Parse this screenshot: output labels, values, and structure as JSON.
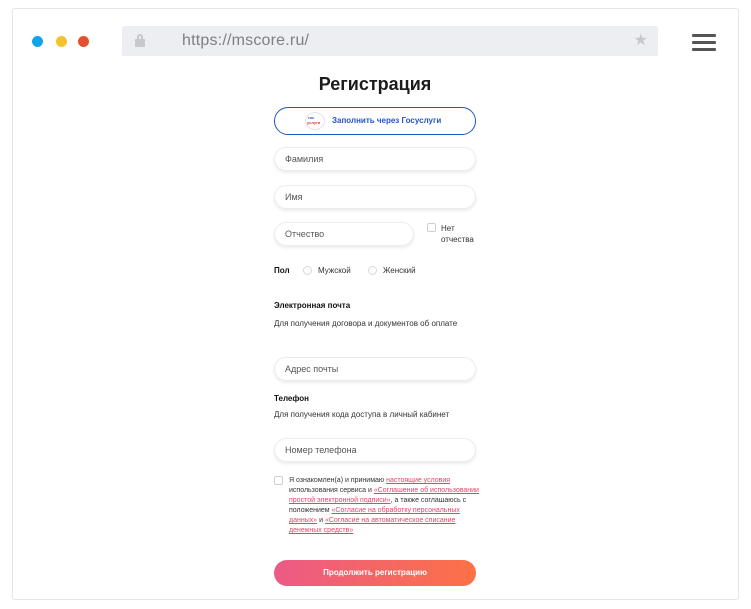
{
  "browser": {
    "url": "https://mscore.ru/",
    "dots": [
      "#14a3e8",
      "#f4c230",
      "#e4502f"
    ]
  },
  "form": {
    "title": "Регистрация",
    "gosuslugi_button": "Заполнить через Госуслуги",
    "gosuslugi_logo_line1": "гос",
    "gosuslugi_logo_line2": "услуги",
    "surname_placeholder": "Фамилия",
    "name_placeholder": "Имя",
    "patronymic_placeholder": "Отчество",
    "no_patronymic_label": "Нет отчества",
    "gender_label": "Пол",
    "gender_male": "Мужской",
    "gender_female": "Женский",
    "email_heading": "Электронная почта",
    "email_hint": "Для получения договора и документов об оплате",
    "email_placeholder": "Адрес почты",
    "phone_heading": "Телефон",
    "phone_hint": "Для получения кода доступа в личный кабинет",
    "phone_placeholder": "Номер телефона",
    "consent": {
      "t1": "Я ознакомлен(а) и принимаю ",
      "l1": "настоящие условия",
      "t2": " использования сервиса и ",
      "l2": "«Соглашение об использовании простой электронной подписи»",
      "t3": ", а также соглашаюсь с положением ",
      "l3": "«Согласие на обработку персональных данных»",
      "t4": " и ",
      "l4": "«Согласие на автоматическое списание денежных средств»"
    },
    "submit_button": "Продолжить регистрацию"
  },
  "colors": {
    "accent_blue": "#2353c7",
    "link_pink": "#e0466a",
    "gradient_start": "#ec5a86",
    "gradient_end": "#fd7146"
  }
}
